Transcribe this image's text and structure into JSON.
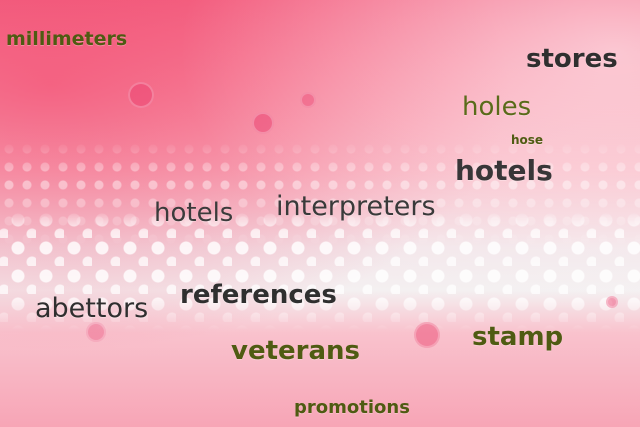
{
  "words": {
    "millimeters": "millimeters",
    "stores": "stores",
    "holes": "holes",
    "hose": "hose",
    "hotels_right": "hotels",
    "hotels_left": "hotels",
    "interpreters": "interpreters",
    "abettors": "abettors",
    "references": "references",
    "stamp": "stamp",
    "veterans": "veterans",
    "promotions": "promotions"
  },
  "colors": {
    "background_pink": "#f7a6b7",
    "background_hot_pink": "#f46c8a",
    "foam_white": "#f4f0f1",
    "text_dark": "#2f2f2f",
    "text_olive": "#4f5b12"
  }
}
